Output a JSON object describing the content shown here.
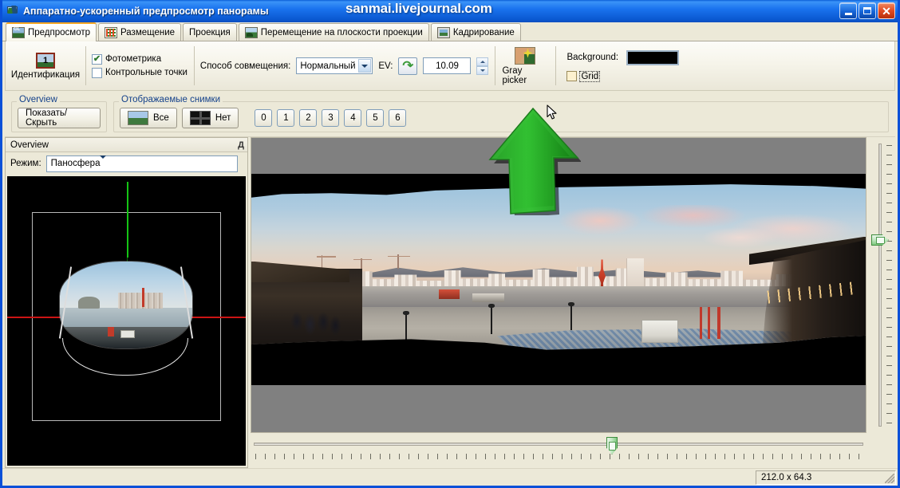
{
  "window": {
    "title": "Аппаратно-ускоренный предпросмотр панорамы",
    "watermark": "sanmai.livejournal.com",
    "minimize_label": "_",
    "maximize_label": "□",
    "close_label": "✕"
  },
  "tabs": [
    {
      "label": "Предпросмотр",
      "icon": "gl-preview-icon",
      "active": true
    },
    {
      "label": "Размещение",
      "icon": "placement-icon",
      "active": false
    },
    {
      "label": "Проекция",
      "icon": "",
      "active": false
    },
    {
      "label": "Перемещение на плоскости проекции",
      "icon": "move-plane-icon",
      "active": false
    },
    {
      "label": "Кадрирование",
      "icon": "crop-icon",
      "active": false
    }
  ],
  "toolbar": {
    "identify_label": "Идентификация",
    "identify_icon_number": "1",
    "photometry_label": "Фотометрика",
    "photometry_checked": true,
    "control_points_label": "Контрольные точки",
    "control_points_checked": false,
    "blend_mode_label": "Способ совмещения:",
    "blend_mode_value": "Нормальный",
    "ev_label": "EV:",
    "ev_value": "10.09",
    "reset_ev_icon": "green-curved-arrow-icon",
    "gray_picker_label": "Gray picker",
    "background_label": "Background:",
    "background_color": "#000000",
    "grid_label": "Grid",
    "grid_checked": false
  },
  "bar2": {
    "overview_group_title": "Overview",
    "show_hide_label": "Показать/Скрыть",
    "images_group_title": "Отображаемые снимки",
    "all_label": "Все",
    "none_label": "Нет",
    "numbers": [
      "0",
      "1",
      "2",
      "3",
      "4",
      "5",
      "6"
    ]
  },
  "left_panel": {
    "header_title": "Overview",
    "pin_icon": "pin-icon",
    "mode_label": "Режим:",
    "mode_value": "Паносфера"
  },
  "status": {
    "dimensions": "212.0 x 64.3"
  }
}
